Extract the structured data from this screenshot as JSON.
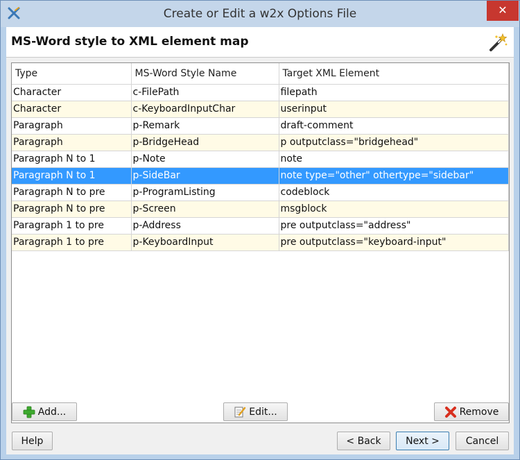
{
  "window": {
    "title": "Create or Edit a w2x Options File",
    "close_glyph": "✕"
  },
  "header": {
    "title": "MS-Word style to XML element map"
  },
  "table": {
    "columns": [
      "Type",
      "MS-Word Style Name",
      "Target XML Element"
    ],
    "rows": [
      [
        "Character",
        "c-FilePath",
        "filepath"
      ],
      [
        "Character",
        "c-KeyboardInputChar",
        "userinput"
      ],
      [
        "Paragraph",
        "p-Remark",
        "draft-comment"
      ],
      [
        "Paragraph",
        "p-BridgeHead",
        "p outputclass=\"bridgehead\""
      ],
      [
        "Paragraph N to 1",
        "p-Note",
        "note"
      ],
      [
        "Paragraph N to 1",
        "p-SideBar",
        "note type=\"other\" othertype=\"sidebar\""
      ],
      [
        "Paragraph N to pre",
        "p-ProgramListing",
        "codeblock"
      ],
      [
        "Paragraph N to pre",
        "p-Screen",
        "msgblock"
      ],
      [
        "Paragraph 1 to pre",
        "p-Address",
        "pre outputclass=\"address\""
      ],
      [
        "Paragraph 1 to pre",
        "p-KeyboardInput",
        "pre outputclass=\"keyboard-input\""
      ]
    ],
    "selected_row": 5
  },
  "buttons": {
    "add": "Add...",
    "edit": "Edit...",
    "remove": "Remove",
    "help": "Help",
    "back": "< Back",
    "next": "Next >",
    "cancel": "Cancel"
  },
  "icons": {
    "app": "w2x-app-icon",
    "wand": "magic-wand-icon",
    "add": "plus-icon",
    "edit": "edit-icon",
    "remove": "red-x-icon"
  },
  "colors": {
    "selection": "#3399ff",
    "alt_row": "#fffbe6",
    "close_button": "#c7372f"
  }
}
